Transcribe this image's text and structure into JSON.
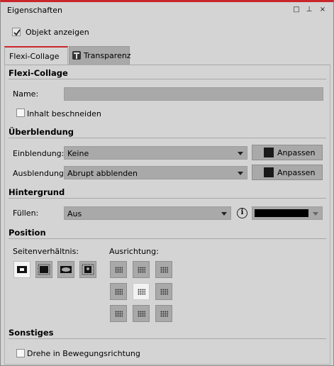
{
  "window": {
    "title": "Eigenschaften",
    "buttons": [
      "□",
      "⊥",
      "×"
    ]
  },
  "top": {
    "show_object_label": "Objekt anzeigen",
    "show_object_checked": true
  },
  "tabs": [
    {
      "label": "Flexi-Collage",
      "active": true
    },
    {
      "label": "Transparenz",
      "active": false,
      "icon": "transparency-icon"
    }
  ],
  "flexi": {
    "section": "Flexi-Collage",
    "name_label": "Name:",
    "name_value": "",
    "crop_label": "Inhalt beschneiden",
    "crop_checked": false
  },
  "blend": {
    "section": "Überblendung",
    "in_label": "Einblendung:",
    "in_value": "Keine",
    "out_label": "Ausblendung:",
    "out_value": "Abrupt abblenden",
    "adjust_label": "Anpassen"
  },
  "background": {
    "section": "Hintergrund",
    "fill_label": "Füllen:",
    "fill_value": "Aus",
    "info_glyph": "i",
    "color": "#000000"
  },
  "position": {
    "section": "Position",
    "ratio_label": "Seitenverhältnis:",
    "align_label": "Ausrichtung:",
    "ratio_selected_index": 0,
    "align_selected_index": 4
  },
  "other": {
    "section": "Sonstiges",
    "rotate_label": "Drehe in Bewegungsrichtung",
    "rotate_checked": false
  },
  "colors": {
    "accent": "#c9262b",
    "panel": "#d4d4d4",
    "control": "#a9a9a9"
  }
}
